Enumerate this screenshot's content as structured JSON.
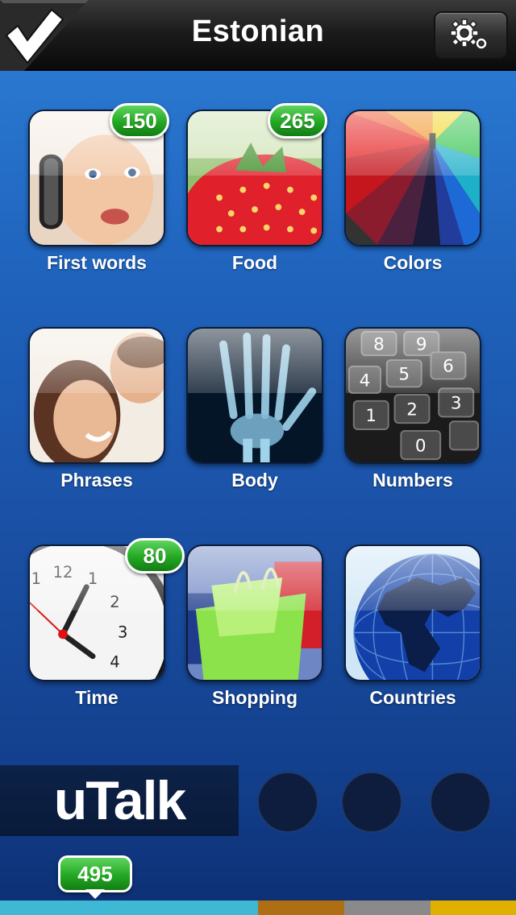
{
  "header": {
    "title": "Estonian",
    "check_icon": "checkmark-icon",
    "settings_icon": "gear-icon"
  },
  "categories": [
    {
      "label": "First words",
      "badge": "150",
      "image": "baby-with-headphones"
    },
    {
      "label": "Food",
      "badge": "265",
      "image": "strawberry"
    },
    {
      "label": "Colors",
      "badge": null,
      "image": "rainbow-umbrella"
    },
    {
      "label": "Phrases",
      "badge": null,
      "image": "smiling-couple"
    },
    {
      "label": "Body",
      "badge": null,
      "image": "hand-x-ray"
    },
    {
      "label": "Numbers",
      "badge": null,
      "image": "calculator-keypad"
    },
    {
      "label": "Time",
      "badge": "80",
      "image": "clock"
    },
    {
      "label": "Shopping",
      "badge": null,
      "image": "shopping-bags"
    },
    {
      "label": "Countries",
      "badge": null,
      "image": "globe"
    }
  ],
  "footer": {
    "brand": "uTalk",
    "total_badge": "495",
    "progress_colors": [
      "#3fb8d6",
      "#b06e14",
      "#8a8a8a",
      "#e0b000"
    ]
  },
  "colors": {
    "badge_green": "#23a823",
    "background_blue": "#1f63bd"
  }
}
